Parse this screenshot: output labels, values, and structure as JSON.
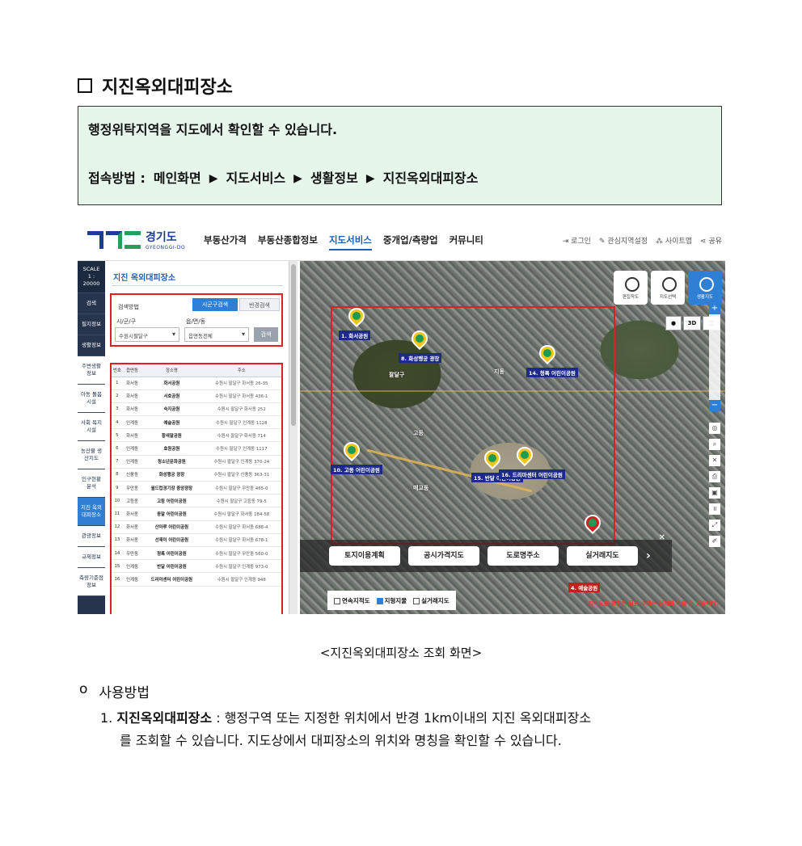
{
  "doc": {
    "title": "지진옥외대피장소",
    "info_line1": "행정위탁지역을 지도에서 확인할 수 있습니다.",
    "access": {
      "label": "접속방법 :",
      "path": [
        "메인화면",
        "지도서비스",
        "생활정보",
        "지진옥외대피장소"
      ]
    },
    "caption": "<지진옥외대피장소 조회 화면>",
    "usage_marker": "o",
    "usage_title": "사용방법",
    "usage_item_num": "1.",
    "usage_item_bold": "지진옥외대피장소",
    "usage_item_text1": " : 행정구역 또는 지정한 위치에서 반경 1km이내의 지진 옥외대피장소",
    "usage_item_text2": "를 조회할 수 있습니다. 지도상에서 대피장소의 위치와 명칭을 확인할 수 있습니다."
  },
  "screenshot": {
    "logo_kr": "경기도",
    "logo_en": "GYEONGGI-DO",
    "gnb": [
      "부동산가격",
      "부동산종합정보",
      "지도서비스",
      "중개업/측량업",
      "커뮤니티"
    ],
    "gnb_active": "지도서비스",
    "util": [
      "로그인",
      "관심지역설정",
      "사이트맵",
      "공유"
    ],
    "leftnav": {
      "scale": "SCALE",
      "scale_val": "1 : 20000",
      "items": [
        "검색",
        "필지정보",
        "생활정보",
        "주변생활 정보",
        "아동 돌봄시설",
        "사회 복지시설",
        "농산물 생산지도",
        "인구현황 분석",
        "지진 옥외 대피장소",
        "관광정보",
        "규제정보",
        "측량기준점 정보"
      ]
    },
    "panel": {
      "title": "지진 옥외대피장소",
      "search_label": "검색방법",
      "tab_a": "시군구검색",
      "tab_b": "반경검색",
      "sel_label1": "시/군/구",
      "sel_label2": "읍/면/동",
      "sel_value1": "수원시팔달구",
      "sel_value2": "읍면동전체",
      "btn_search": "검색",
      "columns": [
        "번호",
        "읍면동",
        "장소명",
        "주소"
      ],
      "rows": [
        [
          "1",
          "화서동",
          "화서공원",
          "수원시 팔달구 화서동 26-35"
        ],
        [
          "2",
          "화서동",
          "서호공원",
          "수원시 팔달구 화서동 436-1"
        ],
        [
          "3",
          "화서동",
          "숙지공원",
          "수원시 팔달구 화서동 252"
        ],
        [
          "4",
          "인계동",
          "예술공원",
          "수원시 팔달구 인계동 1128"
        ],
        [
          "5",
          "화서동",
          "황새말공원",
          "수원시 팔달구 화서동 714"
        ],
        [
          "6",
          "인계동",
          "효원공원",
          "수원시 팔달구 인계동 1117"
        ],
        [
          "7",
          "인계동",
          "청소년문화공원",
          "수원시 팔달구 인계동 370-24"
        ],
        [
          "8",
          "신풍동",
          "화성행궁 광장",
          "수원시 팔달구 신풍동 363-31"
        ],
        [
          "9",
          "우만동",
          "월드컵경기장 중앙광장",
          "수원시 팔달구 우만동 465-0"
        ],
        [
          "10",
          "고등동",
          "고등 어린이공원",
          "수원시 팔달구 고등동 79-5"
        ],
        [
          "11",
          "화서동",
          "동말 어린이공원",
          "수원시 팔달구 화서동 184-58"
        ],
        [
          "12",
          "화서동",
          "산마루 어린이공원",
          "수원시 팔달구 화서동 688-4"
        ],
        [
          "13",
          "화서동",
          "선재미 어린이공원",
          "수원시 팔달구 화서동 678-1"
        ],
        [
          "14",
          "우만동",
          "청록 어린이공원",
          "수원시 팔달구 우만동 560-0"
        ],
        [
          "15",
          "인계동",
          "반달 어린이공원",
          "수원시 팔달구 인계동 973-0"
        ],
        [
          "16",
          "인계동",
          "드리마센터 어린이공원",
          "수원시 팔달구 인계동 948"
        ]
      ]
    },
    "map": {
      "tools": [
        "편집작도",
        "지도선택",
        "생활지도"
      ],
      "mini": [
        "3D"
      ],
      "layers": [
        "토지이용계획",
        "공시가격지도",
        "도로명주소",
        "실거래지도"
      ],
      "checks": [
        "연속지적도",
        "지형지물",
        "실거래지도"
      ],
      "checks_on": [
        false,
        true,
        false
      ],
      "markers": [
        {
          "label": "1. 화서공원"
        },
        {
          "label": "8. 화성행궁 광장"
        },
        {
          "label": "14. 청록 어린이공원"
        },
        {
          "label": "10. 고등 어린이공원"
        },
        {
          "label": "15. 반달 어린이공원"
        },
        {
          "label": "16. 드리마센터 어린이공원"
        },
        {
          "label": "4. 예술공원"
        }
      ],
      "places": [
        "팔달구",
        "지동",
        "고등",
        "매교동"
      ],
      "warning": "지적도를 포함한 모든 수치는 실제와 다를 수 있습니다."
    }
  }
}
